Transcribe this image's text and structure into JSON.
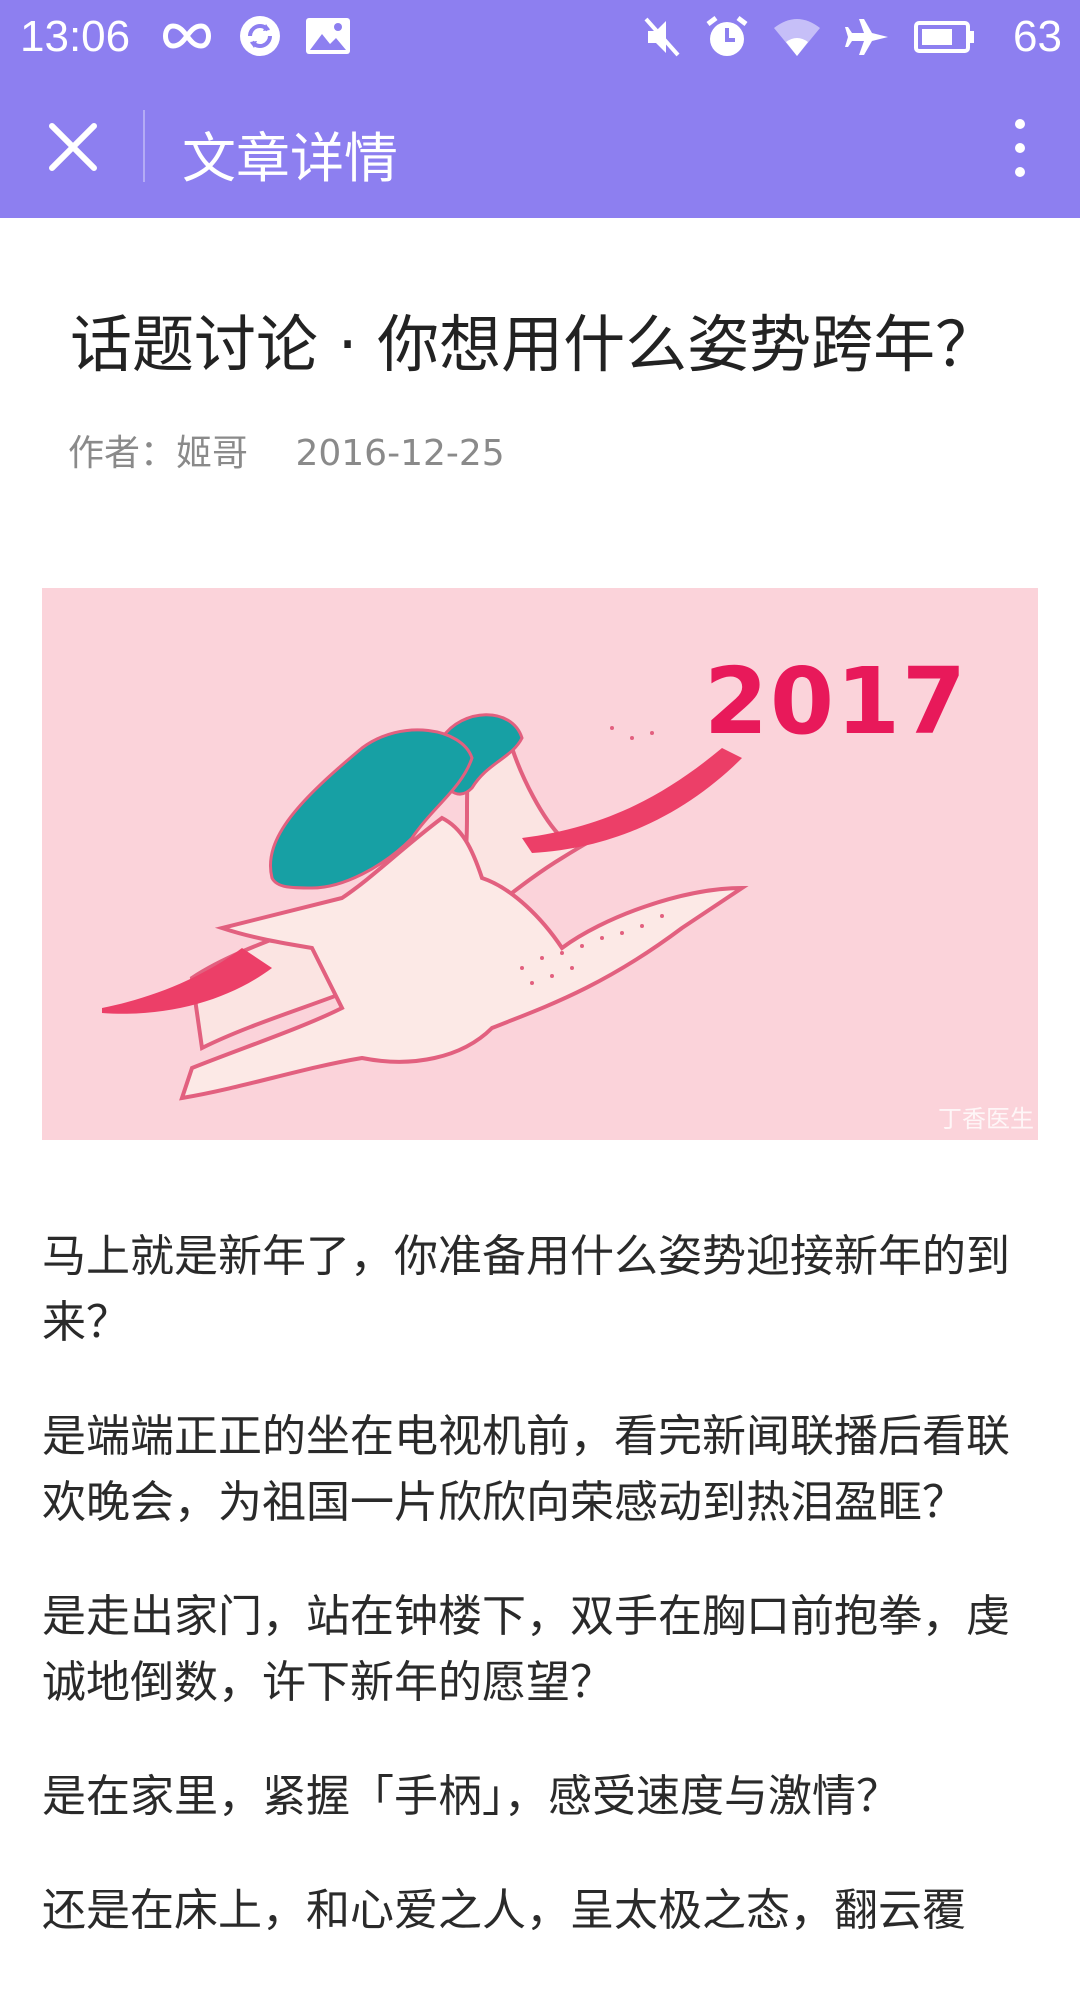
{
  "status_bar": {
    "time": "13:06",
    "battery_percent": "63",
    "left_icons": [
      "infinity-icon",
      "sync-badge-icon",
      "image-icon"
    ],
    "right_icons": [
      "mute-icon",
      "alarm-icon",
      "wifi-icon",
      "airplane-icon",
      "battery-icon"
    ]
  },
  "app_bar": {
    "title": "文章详情",
    "close_icon": "close-icon",
    "more_icon": "more-vertical-icon",
    "background_color": "#8d7ff0"
  },
  "article": {
    "title": "话题讨论 · 你想用什么姿势跨年？",
    "author": "作者：姬哥",
    "date": "2016-12-25",
    "hero_image": {
      "year_text": "2017",
      "watermark": "丁香医生",
      "background_color": "#fbd3da",
      "accent_color": "#e8195a"
    },
    "paragraphs": [
      "马上就是新年了，你准备用什么姿势迎接新年的到来？",
      "是端端正正的坐在电视机前，看完新闻联播后看联欢晚会，为祖国一片欣欣向荣感动到热泪盈眶？",
      "是走出家门，站在钟楼下，双手在胸口前抱拳，虔诚地倒数，许下新年的愿望？",
      "是在家里，紧握「手柄」，感受速度与激情？",
      "还是在床上，和心爱之人，呈太极之态，翻云覆"
    ]
  }
}
